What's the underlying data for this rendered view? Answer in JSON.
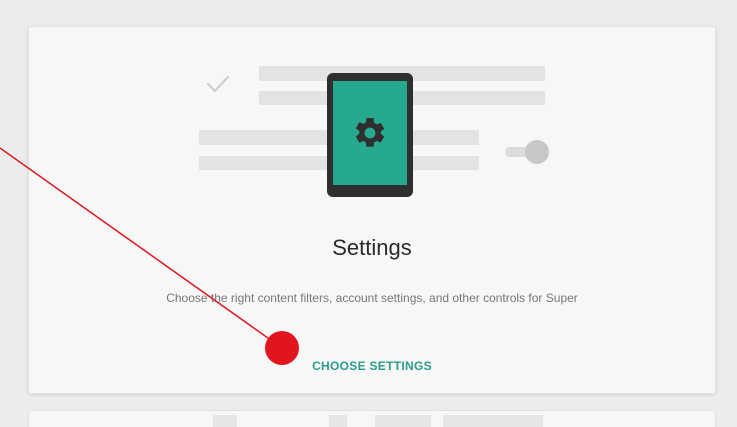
{
  "card": {
    "title": "Settings",
    "description": "Choose the right content filters, account settings, and other controls for Super",
    "action_label": "CHOOSE SETTINGS"
  },
  "illustration": {
    "device_icon": "tablet-icon",
    "device_screen_icon": "gear-icon",
    "decor_icons": [
      "check-icon",
      "toggle-switch-icon"
    ]
  },
  "colors": {
    "accent": "#2a9d8a",
    "device_screen": "#26a98f",
    "device_body": "#2f2f2f",
    "annotation": "#e0151d"
  }
}
